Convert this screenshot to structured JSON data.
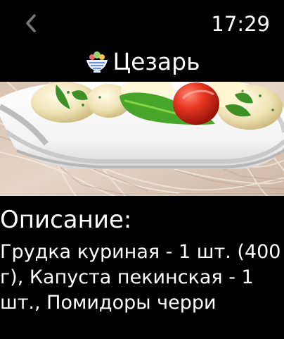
{
  "header": {
    "back_icon": "chevron-left-icon",
    "time": "17:29"
  },
  "recipe": {
    "icon": "salad-bowl-icon",
    "title": "Цезарь",
    "photo_label": "salad-photo",
    "description_heading": "Описание:",
    "description": "Грудка куриная - 1 шт. (400 г), Капуста пекинская - 1 шт., Помидоры черри"
  },
  "colors": {
    "background": "#000000",
    "text": "#ffffff",
    "back_icon": "#777777"
  }
}
